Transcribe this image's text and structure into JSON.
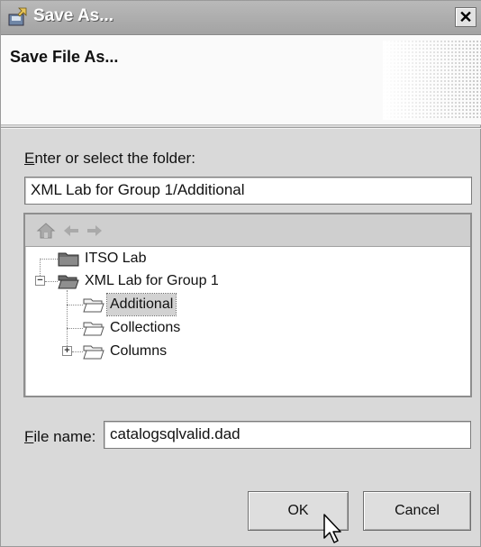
{
  "window": {
    "title": "Save As...",
    "close_symbol": "✕"
  },
  "banner": {
    "title": "Save File As..."
  },
  "folder": {
    "label_mnemonic": "E",
    "label_rest": "nter or select the folder:",
    "value": "XML Lab for Group 1/Additional"
  },
  "tree": {
    "toolbar": [
      "home-icon",
      "back-arrow-icon",
      "forward-arrow-icon"
    ],
    "items": [
      {
        "label": "ITSO Lab"
      },
      {
        "label": "XML Lab for Group 1"
      },
      {
        "label": "Additional"
      },
      {
        "label": "Collections"
      },
      {
        "label": "Columns"
      }
    ]
  },
  "file_name": {
    "label_mnemonic": "F",
    "label_rest": "ile name:",
    "value": "catalogsqlvalid.dad"
  },
  "buttons": {
    "ok": "OK",
    "cancel": "Cancel"
  },
  "colors": {
    "window_bg": "#d9d9d9",
    "selection": "#d2d2d2",
    "banner_bg": "#fafafa"
  }
}
